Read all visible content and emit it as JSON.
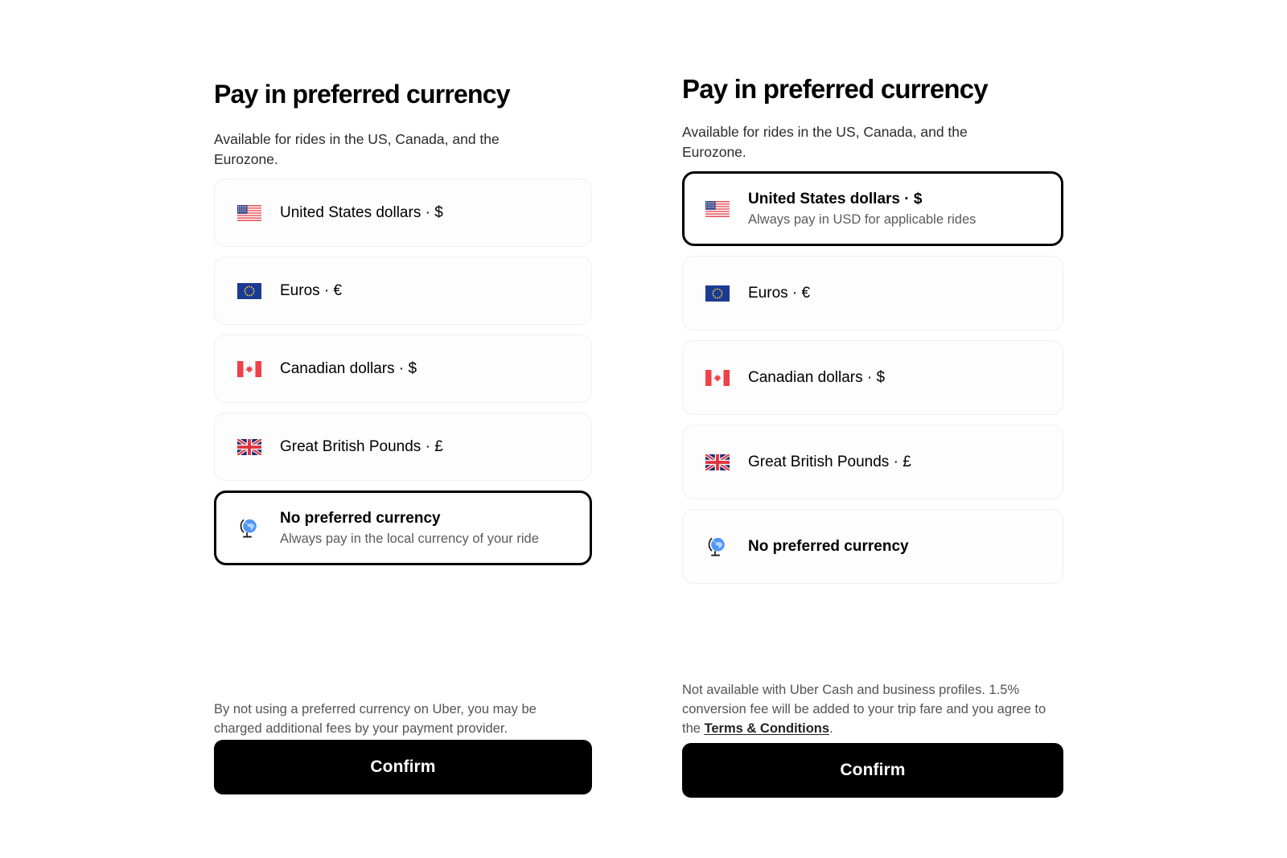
{
  "page": {
    "background": "#ffffff",
    "accent_black": "#000000",
    "card_border": "#efefef",
    "muted_text": "#545454"
  },
  "panels": [
    {
      "id": "left-panel",
      "title": "Pay in preferred currency",
      "subtitle": "Available for rides in the US, Canada, and the Eurozone.",
      "options": [
        {
          "id": "usd",
          "icon": "flag-united-states-icon",
          "label": "United States dollars · $",
          "sublabel": "",
          "selected": false,
          "emphasis": false
        },
        {
          "id": "eur",
          "icon": "flag-european-union-icon",
          "label": "Euros · €",
          "sublabel": "",
          "selected": false,
          "emphasis": false
        },
        {
          "id": "cad",
          "icon": "flag-canada-icon",
          "label": "Canadian dollars · $",
          "sublabel": "",
          "selected": false,
          "emphasis": false
        },
        {
          "id": "gbp",
          "icon": "flag-united-kingdom-icon",
          "label": "Great British Pounds · £",
          "sublabel": "",
          "selected": false,
          "emphasis": false
        },
        {
          "id": "none",
          "icon": "globe-icon",
          "label": "No preferred currency",
          "sublabel": "Always pay in the local currency of your ride",
          "selected": true,
          "emphasis": true
        }
      ],
      "footnote": {
        "before": "By not using a preferred currency on Uber, you may be charged additional fees by your payment provider.",
        "link": "",
        "after": ""
      },
      "confirm_label": "Confirm"
    },
    {
      "id": "right-panel",
      "title": "Pay in preferred currency",
      "subtitle": "Available for rides in the US, Canada, and the Eurozone.",
      "options": [
        {
          "id": "usd",
          "icon": "flag-united-states-icon",
          "label": "United States dollars · $",
          "sublabel": "Always pay in USD for applicable rides",
          "selected": true,
          "emphasis": true
        },
        {
          "id": "eur",
          "icon": "flag-european-union-icon",
          "label": "Euros · €",
          "sublabel": "",
          "selected": false,
          "emphasis": false
        },
        {
          "id": "cad",
          "icon": "flag-canada-icon",
          "label": "Canadian dollars · $",
          "sublabel": "",
          "selected": false,
          "emphasis": false
        },
        {
          "id": "gbp",
          "icon": "flag-united-kingdom-icon",
          "label": "Great British Pounds · £",
          "sublabel": "",
          "selected": false,
          "emphasis": false
        },
        {
          "id": "none",
          "icon": "globe-icon",
          "label": "No preferred currency",
          "sublabel": "",
          "selected": false,
          "emphasis": true
        }
      ],
      "footnote": {
        "before": "Not available with Uber Cash and business profiles. 1.5% conversion fee will be added to your trip fare and you agree to the ",
        "link": "Terms & Conditions",
        "after": "."
      },
      "confirm_label": "Confirm"
    }
  ]
}
